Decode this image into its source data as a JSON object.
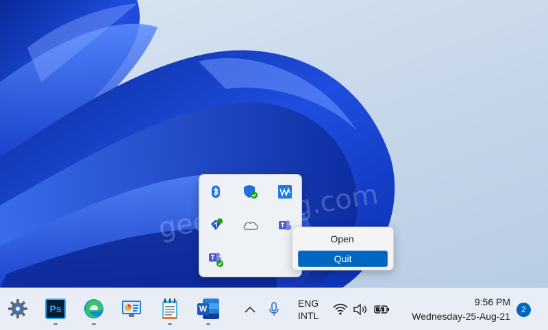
{
  "context_menu": {
    "open_label": "Open",
    "quit_label": "Quit"
  },
  "tray_flyout": {
    "icons": [
      "bluetooth-icon",
      "windows-security-icon",
      "waves-app-icon",
      "bluetooth-connected-app-icon",
      "onedrive-cloud-icon",
      "teams-icon",
      "teams-personal-icon"
    ]
  },
  "taskbar": {
    "apps": [
      "settings",
      "photoshop",
      "edge",
      "control-panel",
      "notepad",
      "word"
    ],
    "photoshop_label": "Ps",
    "word_label": "W",
    "language": {
      "line1": "ENG",
      "line2": "INTL"
    },
    "clock": {
      "time": "9:56 PM",
      "date": "Wednesday-25-Aug-21"
    },
    "notification_count": "2"
  },
  "watermark": "geekermag.com",
  "colors": {
    "accent": "#0067c0",
    "wallpaper_blue": "#1f45d6"
  }
}
